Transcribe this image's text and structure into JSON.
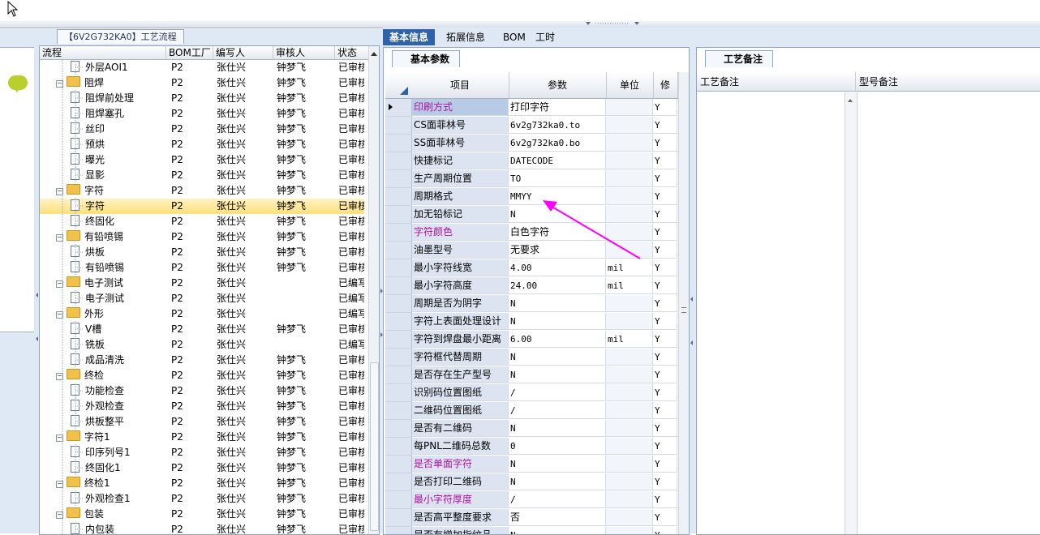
{
  "tree": {
    "tab_title": "【6V2G732KA0】工艺流程",
    "columns": [
      "流程",
      "BOM工厂",
      "编写人",
      "审核人",
      "状态"
    ],
    "rows": [
      {
        "level": 2,
        "kind": "doc",
        "name": "外层AOI1",
        "bom": "P2",
        "writer": "张仕兴",
        "reviewer": "钟梦飞",
        "status": "已审核"
      },
      {
        "level": 1,
        "kind": "folder",
        "name": "阻焊",
        "bom": "P2",
        "writer": "张仕兴",
        "reviewer": "钟梦飞",
        "status": "已审核"
      },
      {
        "level": 2,
        "kind": "doc",
        "name": "阻焊前处理",
        "bom": "P2",
        "writer": "张仕兴",
        "reviewer": "钟梦飞",
        "status": "已审核"
      },
      {
        "level": 2,
        "kind": "doc",
        "name": "阻焊塞孔",
        "bom": "P2",
        "writer": "张仕兴",
        "reviewer": "钟梦飞",
        "status": "已审核"
      },
      {
        "level": 2,
        "kind": "doc",
        "name": "丝印",
        "bom": "P2",
        "writer": "张仕兴",
        "reviewer": "钟梦飞",
        "status": "已审核"
      },
      {
        "level": 2,
        "kind": "doc",
        "name": "预烘",
        "bom": "P2",
        "writer": "张仕兴",
        "reviewer": "钟梦飞",
        "status": "已审核"
      },
      {
        "level": 2,
        "kind": "doc",
        "name": "曝光",
        "bom": "P2",
        "writer": "张仕兴",
        "reviewer": "钟梦飞",
        "status": "已审核"
      },
      {
        "level": 2,
        "kind": "doc",
        "name": "显影",
        "bom": "P2",
        "writer": "张仕兴",
        "reviewer": "钟梦飞",
        "status": "已审核"
      },
      {
        "level": 1,
        "kind": "folder",
        "name": "字符",
        "bom": "P2",
        "writer": "张仕兴",
        "reviewer": "钟梦飞",
        "status": "已审核"
      },
      {
        "level": 2,
        "kind": "doc",
        "name": "字符",
        "bom": "P2",
        "writer": "张仕兴",
        "reviewer": "钟梦飞",
        "status": "已审核",
        "selected": true
      },
      {
        "level": 2,
        "kind": "doc",
        "name": "终固化",
        "bom": "P2",
        "writer": "张仕兴",
        "reviewer": "钟梦飞",
        "status": "已审核"
      },
      {
        "level": 1,
        "kind": "folder",
        "name": "有铅喷锡",
        "bom": "P2",
        "writer": "张仕兴",
        "reviewer": "钟梦飞",
        "status": "已审核"
      },
      {
        "level": 2,
        "kind": "doc",
        "name": "烘板",
        "bom": "P2",
        "writer": "张仕兴",
        "reviewer": "钟梦飞",
        "status": "已审核"
      },
      {
        "level": 2,
        "kind": "doc",
        "name": "有铅喷锡",
        "bom": "P2",
        "writer": "张仕兴",
        "reviewer": "钟梦飞",
        "status": "已审核"
      },
      {
        "level": 1,
        "kind": "folder",
        "name": "电子测试",
        "bom": "P2",
        "writer": "张仕兴",
        "reviewer": "",
        "status": "已编写"
      },
      {
        "level": 2,
        "kind": "doc",
        "name": "电子测试",
        "bom": "P2",
        "writer": "张仕兴",
        "reviewer": "",
        "status": "已编写"
      },
      {
        "level": 1,
        "kind": "folder",
        "name": "外形",
        "bom": "P2",
        "writer": "张仕兴",
        "reviewer": "",
        "status": "已编写"
      },
      {
        "level": 2,
        "kind": "doc",
        "name": "V槽",
        "bom": "P2",
        "writer": "张仕兴",
        "reviewer": "钟梦飞",
        "status": "已审核"
      },
      {
        "level": 2,
        "kind": "doc",
        "name": "铣板",
        "bom": "P2",
        "writer": "张仕兴",
        "reviewer": "",
        "status": "已编写"
      },
      {
        "level": 2,
        "kind": "doc",
        "name": "成品清洗",
        "bom": "P2",
        "writer": "张仕兴",
        "reviewer": "钟梦飞",
        "status": "已审核"
      },
      {
        "level": 1,
        "kind": "folder",
        "name": "终检",
        "bom": "P2",
        "writer": "张仕兴",
        "reviewer": "钟梦飞",
        "status": "已审核"
      },
      {
        "level": 2,
        "kind": "doc",
        "name": "功能检查",
        "bom": "P2",
        "writer": "张仕兴",
        "reviewer": "钟梦飞",
        "status": "已审核"
      },
      {
        "level": 2,
        "kind": "doc",
        "name": "外观检查",
        "bom": "P2",
        "writer": "张仕兴",
        "reviewer": "钟梦飞",
        "status": "已审核"
      },
      {
        "level": 2,
        "kind": "doc",
        "name": "烘板整平",
        "bom": "P2",
        "writer": "张仕兴",
        "reviewer": "钟梦飞",
        "status": "已审核"
      },
      {
        "level": 1,
        "kind": "folder",
        "name": "字符1",
        "bom": "P2",
        "writer": "张仕兴",
        "reviewer": "钟梦飞",
        "status": "已审核"
      },
      {
        "level": 2,
        "kind": "doc",
        "name": "印序列号1",
        "bom": "P2",
        "writer": "张仕兴",
        "reviewer": "钟梦飞",
        "status": "已审核"
      },
      {
        "level": 2,
        "kind": "doc",
        "name": "终固化1",
        "bom": "P2",
        "writer": "张仕兴",
        "reviewer": "钟梦飞",
        "status": "已审核"
      },
      {
        "level": 1,
        "kind": "folder",
        "name": "终检1",
        "bom": "P2",
        "writer": "张仕兴",
        "reviewer": "钟梦飞",
        "status": "已审核"
      },
      {
        "level": 2,
        "kind": "doc",
        "name": "外观检查1",
        "bom": "P2",
        "writer": "张仕兴",
        "reviewer": "钟梦飞",
        "status": "已审核"
      },
      {
        "level": 1,
        "kind": "folder",
        "name": "包装",
        "bom": "P2",
        "writer": "张仕兴",
        "reviewer": "钟梦飞",
        "status": "已审核"
      },
      {
        "level": 2,
        "kind": "doc",
        "name": "内包装",
        "bom": "P2",
        "writer": "张仕兴",
        "reviewer": "钟梦飞",
        "status": "已审核"
      }
    ]
  },
  "top_tabs": [
    "基本信息",
    "拓展信息",
    "BOM",
    "工时"
  ],
  "basic": {
    "subtab": "基本参数",
    "columns": [
      "项目",
      "参数",
      "单位",
      "修"
    ],
    "rows": [
      {
        "item": "印刷方式",
        "value": "打印字符",
        "unit": "",
        "flag": "Y",
        "highlight": true
      },
      {
        "item": "CS面菲林号",
        "value": "6v2g732ka0.to",
        "unit": "",
        "flag": "Y"
      },
      {
        "item": "SS面菲林号",
        "value": "6v2g732ka0.bo",
        "unit": "",
        "flag": "Y"
      },
      {
        "item": "快捷标记",
        "value": "DATECODE",
        "unit": "",
        "flag": "Y"
      },
      {
        "item": "生产周期位置",
        "value": "TO",
        "unit": "",
        "flag": "Y"
      },
      {
        "item": "周期格式",
        "value": "MMYY",
        "unit": "",
        "flag": "Y"
      },
      {
        "item": "加无铅标记",
        "value": "N",
        "unit": "",
        "flag": "Y"
      },
      {
        "item": "字符颜色",
        "value": "白色字符",
        "unit": "",
        "flag": "Y",
        "highlight": true
      },
      {
        "item": "油墨型号",
        "value": "无要求",
        "unit": "",
        "flag": "Y"
      },
      {
        "item": "最小字符线宽",
        "value": "4.00",
        "unit": "mil",
        "flag": "Y"
      },
      {
        "item": "最小字符高度",
        "value": "24.00",
        "unit": "mil",
        "flag": "Y"
      },
      {
        "item": "周期是否为阴字",
        "value": "N",
        "unit": "",
        "flag": "Y"
      },
      {
        "item": "字符上表面处理设计",
        "value": "N",
        "unit": "",
        "flag": "Y"
      },
      {
        "item": "字符到焊盘最小距离",
        "value": "6.00",
        "unit": "mil",
        "flag": "Y"
      },
      {
        "item": "字符框代替周期",
        "value": "N",
        "unit": "",
        "flag": "Y"
      },
      {
        "item": "是否存在生产型号",
        "value": "N",
        "unit": "",
        "flag": "Y"
      },
      {
        "item": "识别码位置图纸",
        "value": "/",
        "unit": "",
        "flag": "Y"
      },
      {
        "item": "二维码位置图纸",
        "value": "/",
        "unit": "",
        "flag": "Y"
      },
      {
        "item": "是否有二维码",
        "value": "N",
        "unit": "",
        "flag": "Y"
      },
      {
        "item": "每PNL二维码总数",
        "value": "0",
        "unit": "",
        "flag": "Y"
      },
      {
        "item": "是否单面字符",
        "value": "N",
        "unit": "",
        "flag": "Y",
        "highlight": true
      },
      {
        "item": "是否打印二维码",
        "value": "N",
        "unit": "",
        "flag": "Y"
      },
      {
        "item": "最小字符厚度",
        "value": "/",
        "unit": "",
        "flag": "Y",
        "highlight": true
      },
      {
        "item": "是否高平整度要求",
        "value": "否",
        "unit": "",
        "flag": "Y"
      },
      {
        "item": "是否有增加指纹品",
        "value": "N",
        "unit": "",
        "flag": "Y"
      }
    ]
  },
  "notes": {
    "subtab": "工艺备注",
    "col1": "工艺备注",
    "col2": "型号备注"
  },
  "colors": {
    "highlight_text": "#b0109f",
    "arrow": "#ff00ff",
    "selected_row": "#ffe079",
    "active_tab": "#2f62a8"
  }
}
